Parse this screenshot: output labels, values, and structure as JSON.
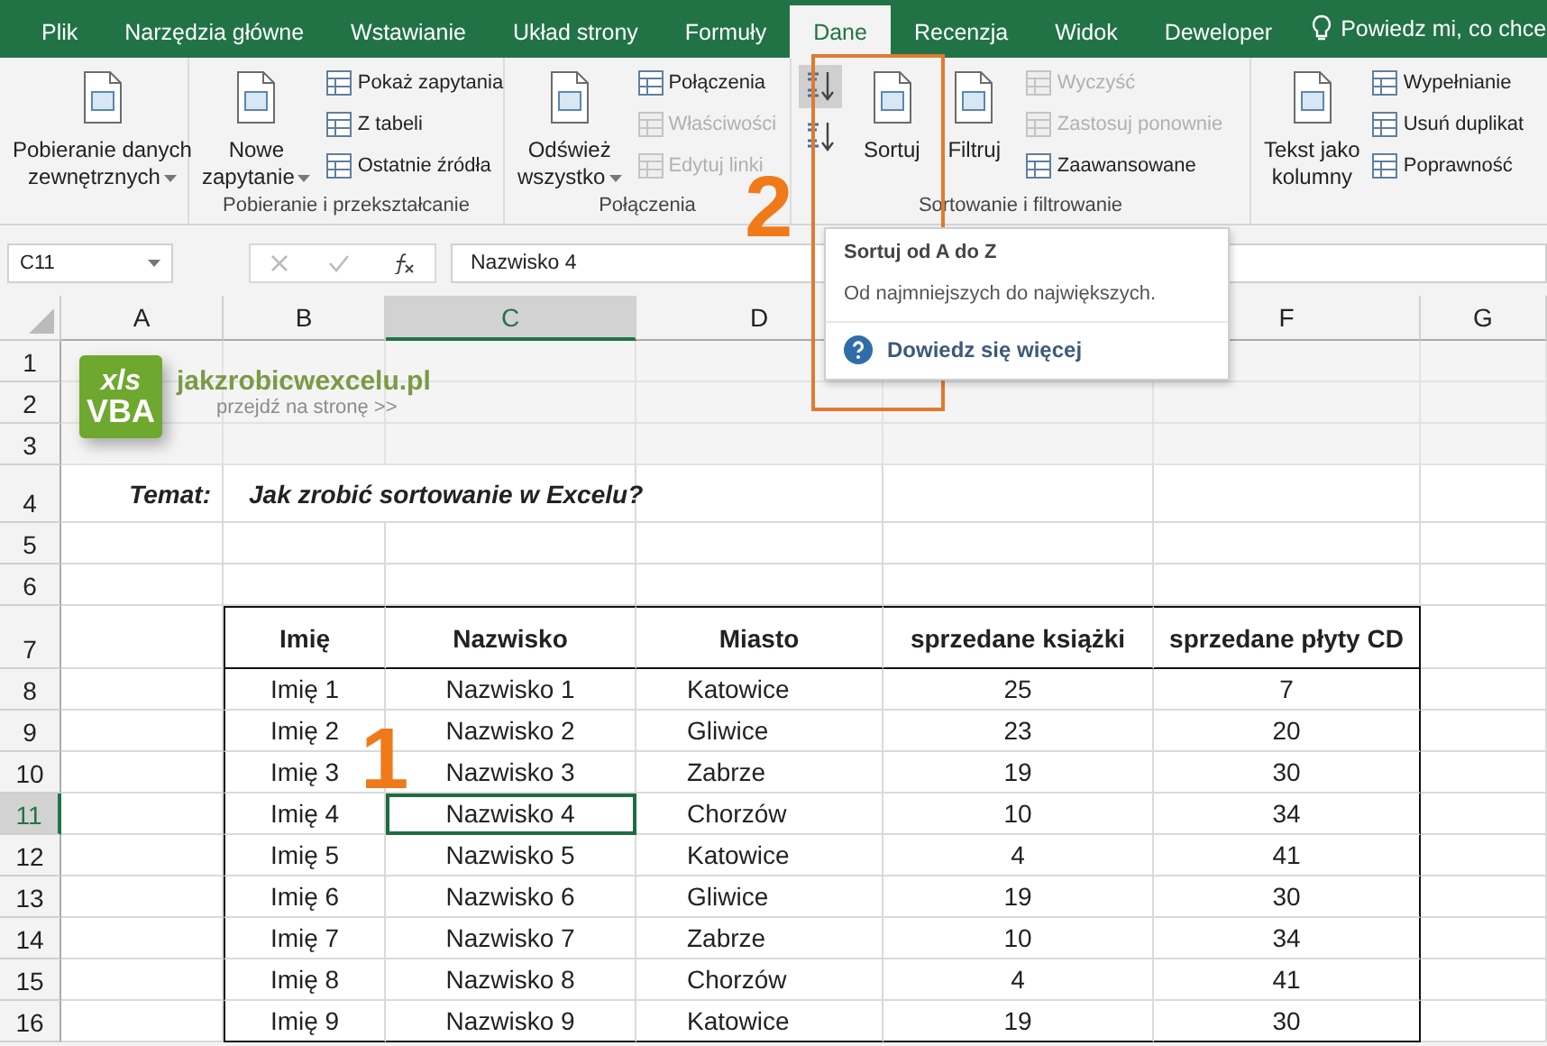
{
  "tabs": [
    {
      "label": "Plik",
      "selected": false
    },
    {
      "label": "Narzędzia główne",
      "selected": false
    },
    {
      "label": "Wstawianie",
      "selected": false
    },
    {
      "label": "Układ strony",
      "selected": false
    },
    {
      "label": "Formuły",
      "selected": false
    },
    {
      "label": "Dane",
      "selected": true
    },
    {
      "label": "Recenzja",
      "selected": false
    },
    {
      "label": "Widok",
      "selected": false
    },
    {
      "label": "Deweloper",
      "selected": false
    }
  ],
  "tell_me": {
    "text": "Powiedz mi, co chce"
  },
  "ribbon_groups": [
    {
      "columns": [
        [
          {
            "kind": "large",
            "lines": [
              "Pobieranie danych",
              "zewnętrznych"
            ],
            "dropdown": true
          }
        ]
      ]
    },
    {
      "label": "Pobieranie i przekształcanie",
      "columns": [
        [
          {
            "kind": "large",
            "lines": [
              "Nowe",
              "zapytanie"
            ],
            "dropdown": true
          }
        ],
        [
          {
            "kind": "small",
            "label": "Pokaż zapytania",
            "disabled": false
          },
          {
            "kind": "small",
            "label": "Z tabeli",
            "disabled": false
          },
          {
            "kind": "small",
            "label": "Ostatnie źródła",
            "disabled": false
          }
        ]
      ]
    },
    {
      "label": "Połączenia",
      "columns": [
        [
          {
            "kind": "large",
            "lines": [
              "Odśwież",
              "wszystko"
            ],
            "dropdown": true
          }
        ],
        [
          {
            "kind": "small",
            "label": "Połączenia",
            "disabled": false
          },
          {
            "kind": "small",
            "label": "Właściwości",
            "disabled": true
          },
          {
            "kind": "small",
            "label": "Edytuj linki",
            "disabled": true
          }
        ]
      ]
    },
    {
      "label": "Sortowanie i filtrowanie",
      "columns": [
        [
          {
            "kind": "icon",
            "selected": true
          },
          {
            "kind": "icon",
            "selected": false
          }
        ],
        [
          {
            "kind": "large",
            "lines": [
              "Sortuj"
            ],
            "dropdown": false
          }
        ],
        [
          {
            "kind": "large",
            "lines": [
              "Filtruj"
            ],
            "dropdown": false
          }
        ],
        [
          {
            "kind": "small",
            "label": "Wyczyść",
            "disabled": true
          },
          {
            "kind": "small",
            "label": "Zastosuj ponownie",
            "disabled": true
          },
          {
            "kind": "small",
            "label": "Zaawansowane",
            "disabled": false
          }
        ]
      ]
    },
    {
      "columns": [
        [
          {
            "kind": "large",
            "lines": [
              "Tekst jako",
              "kolumny"
            ],
            "dropdown": false
          }
        ],
        [
          {
            "kind": "small",
            "label": "Wypełnianie",
            "disabled": false
          },
          {
            "kind": "small",
            "label": "Usuń duplikat",
            "disabled": false
          },
          {
            "kind": "small",
            "label": "Poprawność",
            "disabled": false
          }
        ]
      ]
    }
  ],
  "formula_bar": {
    "name_box": "C11",
    "value": "Nazwisko 4"
  },
  "columns": [
    {
      "label": "A",
      "selected": false
    },
    {
      "label": "B",
      "selected": false
    },
    {
      "label": "C",
      "selected": true
    },
    {
      "label": "D",
      "selected": false
    },
    {
      "label": "F",
      "selected": false
    },
    {
      "label": "G",
      "selected": false
    }
  ],
  "rows": [
    {
      "label": "1",
      "selected": false
    },
    {
      "label": "2",
      "selected": false
    },
    {
      "label": "3",
      "selected": false
    },
    {
      "label": "4",
      "selected": false
    },
    {
      "label": "5",
      "selected": false
    },
    {
      "label": "6",
      "selected": false
    },
    {
      "label": "7",
      "selected": false
    },
    {
      "label": "8",
      "selected": false
    },
    {
      "label": "9",
      "selected": false
    },
    {
      "label": "10",
      "selected": false
    },
    {
      "label": "11",
      "selected": true
    },
    {
      "label": "12",
      "selected": false
    },
    {
      "label": "13",
      "selected": false
    },
    {
      "label": "14",
      "selected": false
    },
    {
      "label": "15",
      "selected": false
    },
    {
      "label": "16",
      "selected": false
    }
  ],
  "banner": {
    "logo_lines": [
      "xls",
      "VBA"
    ],
    "site": "jakzrobicwexcelu.pl",
    "link": "przejdź na stronę >>"
  },
  "topic": {
    "label": "Temat:",
    "value": "Jak zrobić sortowanie w Excelu?"
  },
  "table": {
    "columns": [
      "Imię",
      "Nazwisko",
      "Miasto",
      "sprzedane książki",
      "sprzedane płyty CD"
    ],
    "rows": [
      {
        "cells": [
          {
            "text": "Imię 1",
            "selected": false
          },
          {
            "text": "Nazwisko 1",
            "selected": false
          },
          {
            "text": "Katowice",
            "selected": false
          },
          {
            "text": "25",
            "selected": false
          },
          {
            "text": "7",
            "selected": false
          }
        ]
      },
      {
        "cells": [
          {
            "text": "Imię 2",
            "selected": false
          },
          {
            "text": "Nazwisko 2",
            "selected": false
          },
          {
            "text": "Gliwice",
            "selected": false
          },
          {
            "text": "23",
            "selected": false
          },
          {
            "text": "20",
            "selected": false
          }
        ]
      },
      {
        "cells": [
          {
            "text": "Imię 3",
            "selected": false
          },
          {
            "text": "Nazwisko 3",
            "selected": false
          },
          {
            "text": "Zabrze",
            "selected": false
          },
          {
            "text": "19",
            "selected": false
          },
          {
            "text": "30",
            "selected": false
          }
        ]
      },
      {
        "cells": [
          {
            "text": "Imię 4",
            "selected": false
          },
          {
            "text": "Nazwisko 4",
            "selected": true
          },
          {
            "text": "Chorzów",
            "selected": false
          },
          {
            "text": "10",
            "selected": false
          },
          {
            "text": "34",
            "selected": false
          }
        ]
      },
      {
        "cells": [
          {
            "text": "Imię 5",
            "selected": false
          },
          {
            "text": "Nazwisko 5",
            "selected": false
          },
          {
            "text": "Katowice",
            "selected": false
          },
          {
            "text": "4",
            "selected": false
          },
          {
            "text": "41",
            "selected": false
          }
        ]
      },
      {
        "cells": [
          {
            "text": "Imię 6",
            "selected": false
          },
          {
            "text": "Nazwisko 6",
            "selected": false
          },
          {
            "text": "Gliwice",
            "selected": false
          },
          {
            "text": "19",
            "selected": false
          },
          {
            "text": "30",
            "selected": false
          }
        ]
      },
      {
        "cells": [
          {
            "text": "Imię 7",
            "selected": false
          },
          {
            "text": "Nazwisko 7",
            "selected": false
          },
          {
            "text": "Zabrze",
            "selected": false
          },
          {
            "text": "10",
            "selected": false
          },
          {
            "text": "34",
            "selected": false
          }
        ]
      },
      {
        "cells": [
          {
            "text": "Imię 8",
            "selected": false
          },
          {
            "text": "Nazwisko 8",
            "selected": false
          },
          {
            "text": "Chorzów",
            "selected": false
          },
          {
            "text": "4",
            "selected": false
          },
          {
            "text": "41",
            "selected": false
          }
        ]
      },
      {
        "cells": [
          {
            "text": "Imię 9",
            "selected": false
          },
          {
            "text": "Nazwisko 9",
            "selected": false
          },
          {
            "text": "Katowice",
            "selected": false
          },
          {
            "text": "19",
            "selected": false
          },
          {
            "text": "30",
            "selected": false
          }
        ]
      }
    ]
  },
  "tooltip": {
    "title": "Sortuj od A do Z",
    "description": "Od najmniejszych do największych.",
    "link": "Dowiedz się więcej"
  },
  "annotations": [
    {
      "kind": "step",
      "text": "1"
    },
    {
      "kind": "step",
      "text": "2"
    }
  ]
}
